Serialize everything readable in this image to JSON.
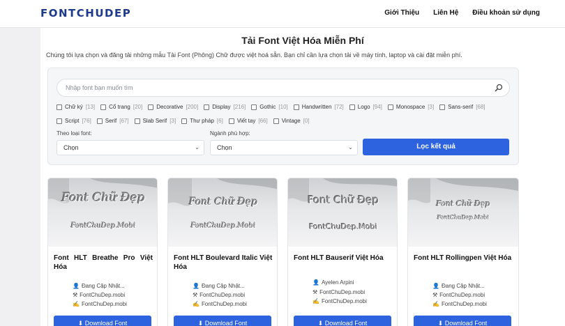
{
  "header": {
    "logo": "FONTCHUDEP",
    "nav": [
      "Giới Thiệu",
      "Liên Hệ",
      "Điều khoản sử dụng"
    ]
  },
  "main": {
    "title": "Tải Font Việt Hóa Miễn Phí",
    "description": "Chúng tôi lựa chọn và đăng tải những mẫu Tải Font (Phông) Chữ được việt hoá sẵn. Bạn chỉ cần lựa chọn tải về máy tính, laptop và cài đặt miễn phí."
  },
  "search": {
    "placeholder": "Nhập font bạn muốn tìm",
    "value": ""
  },
  "categories": [
    {
      "label": "Chữ ký",
      "count": "[13]"
    },
    {
      "label": "Cổ trang",
      "count": "[20]"
    },
    {
      "label": "Decorative",
      "count": "[200]"
    },
    {
      "label": "Display",
      "count": "[216]"
    },
    {
      "label": "Gothic",
      "count": "[10]"
    },
    {
      "label": "Handwritten",
      "count": "[72]"
    },
    {
      "label": "Logo",
      "count": "[94]"
    },
    {
      "label": "Monospace",
      "count": "[3]"
    },
    {
      "label": "Sans-serif",
      "count": "[68]"
    },
    {
      "label": "Script",
      "count": "[76]"
    },
    {
      "label": "Serif",
      "count": "[67]"
    },
    {
      "label": "Slab Serif",
      "count": "[3]"
    },
    {
      "label": "Thư pháp",
      "count": "[6]"
    },
    {
      "label": "Viết tay",
      "count": "[66]"
    },
    {
      "label": "Vintage",
      "count": "[0]"
    }
  ],
  "filters": {
    "type_label": "Theo loại font:",
    "type_value": "Chọn",
    "industry_label": "Ngành phù hợp:",
    "industry_value": "Chọn",
    "button": "Lọc kết quả"
  },
  "cards": [
    {
      "title": "Font HLT Breathe Pro Việt Hóa",
      "author": "Đang Cập Nhật...",
      "site": "FontChuDep.mobi",
      "source": "FontChuDep.mobi",
      "preview1": "Font Chữ Đẹp",
      "preview2": "FontChuDep.Mobi",
      "download": "Download Font"
    },
    {
      "title": "Font HLT Boulevard Italic Việt Hóa",
      "author": "Đang Cập Nhật...",
      "site": "FontChuDep.mobi",
      "source": "FontChuDep.mobi",
      "preview1": "Font Chữ Đẹp",
      "preview2": "FontChuDep.Mobi",
      "download": "Download Font"
    },
    {
      "title": "Font HLT Bauserif Việt Hóa",
      "author": "Ayelen Arpini",
      "site": "FontChuDep.mobi",
      "source": "FontChuDep.mobi",
      "preview1": "Font Chữ Đẹp",
      "preview2": "FontChuDep.Mobi",
      "download": "Download Font"
    },
    {
      "title": "Font HLT Rollingpen Việt Hóa",
      "author": "Đang Cập Nhật...",
      "site": "FontChuDep.mobi",
      "source": "FontChuDep.mobi",
      "preview1": "Font Chữ Đẹp",
      "preview2": "FontChuDep.Mobi",
      "download": "Download Font"
    }
  ],
  "icons": {
    "user": "user-icon",
    "tools": "tools-icon",
    "pen": "pen-icon",
    "download": "download-icon",
    "search": "search-icon"
  },
  "colors": {
    "brand": "#1e3a8a",
    "accent": "#2e63e0"
  }
}
